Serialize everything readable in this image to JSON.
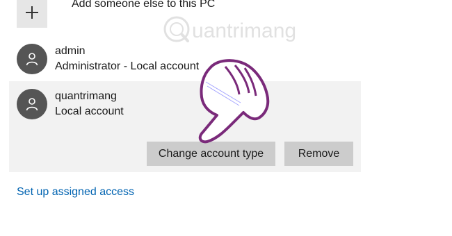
{
  "add_person": {
    "label": "Add someone else to this PC",
    "icon": "plus-icon"
  },
  "accounts": [
    {
      "name": "admin",
      "type": "Administrator - Local account",
      "icon": "person-icon"
    },
    {
      "name": "quantrimang",
      "type": "Local account",
      "icon": "person-icon"
    }
  ],
  "selected_account": {
    "buttons": {
      "change_type": "Change account type",
      "remove": "Remove"
    }
  },
  "assigned_access_link": "Set up assigned access",
  "watermark": {
    "brand": "uantrimang"
  },
  "colors": {
    "accent_link": "#0063b1",
    "avatar": "#555555",
    "panel": "#f2f2f2",
    "button": "#cccccc",
    "hand_outline": "#7a2a7a"
  }
}
